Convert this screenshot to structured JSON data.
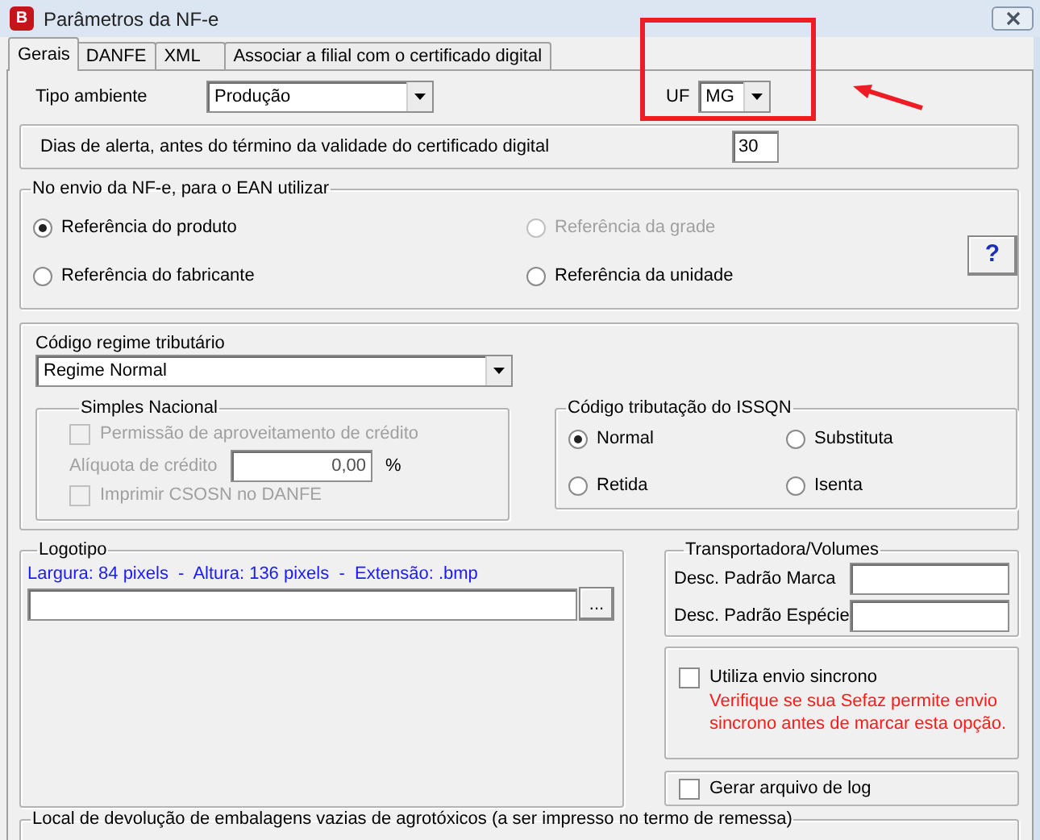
{
  "window": {
    "icon_letter": "B",
    "title": "Parâmetros da NF-e"
  },
  "tabs": [
    {
      "label": "Gerais",
      "selected": true
    },
    {
      "label": "DANFE",
      "selected": false
    },
    {
      "label": "XML",
      "selected": false
    },
    {
      "label": "Associar a filial com o certificado digital",
      "selected": false
    }
  ],
  "tipo_ambiente": {
    "label": "Tipo ambiente",
    "value": "Produção"
  },
  "uf": {
    "label": "UF",
    "value": "MG"
  },
  "dias_alerta": {
    "label": "Dias de alerta, antes do término da validade do certificado digital",
    "value": "30"
  },
  "ean": {
    "title": "No envio da NF-e, para o EAN utilizar",
    "help": "?",
    "options": [
      {
        "label": "Referência do produto",
        "selected": true,
        "disabled": false
      },
      {
        "label": "Referência da grade",
        "selected": false,
        "disabled": true
      },
      {
        "label": "Referência do fabricante",
        "selected": false,
        "disabled": false
      },
      {
        "label": "Referência da unidade",
        "selected": false,
        "disabled": false
      }
    ]
  },
  "regime": {
    "label": "Código regime tributário",
    "value": "Regime Normal"
  },
  "simples_nacional": {
    "title": "Simples Nacional",
    "disabled": true,
    "permissao": {
      "label": "Permissão de aproveitamento de crédito",
      "checked": false
    },
    "aliquota": {
      "label": "Alíquota de crédito",
      "value": "0,00",
      "unit": "%"
    },
    "imprimir": {
      "label": "Imprimir CSOSN no DANFE",
      "checked": false
    }
  },
  "issqn": {
    "title": "Código tributação do ISSQN",
    "options": [
      {
        "label": "Normal",
        "selected": true
      },
      {
        "label": "Substituta",
        "selected": false
      },
      {
        "label": "Retida",
        "selected": false
      },
      {
        "label": "Isenta",
        "selected": false
      }
    ]
  },
  "logotipo": {
    "title": "Logotipo",
    "hint": "Largura: 84 pixels  -  Altura: 136 pixels  -  Extensão: .bmp",
    "browse": "..."
  },
  "transportadora": {
    "title": "Transportadora/Volumes",
    "fields": [
      {
        "label": "Desc. Padrão Marca"
      },
      {
        "label": "Desc. Padrão Espécie"
      }
    ]
  },
  "sincrono": {
    "label": "Utiliza envio sincrono",
    "checked": false,
    "warning": "Verifique se sua Sefaz permite envio sincrono antes de marcar esta opção."
  },
  "log": {
    "label": "Gerar arquivo de log",
    "checked": false
  },
  "devolucao": {
    "title": "Local de devolução de embalagens vazias de agrotóxicos (a ser impresso no termo de remessa)"
  }
}
